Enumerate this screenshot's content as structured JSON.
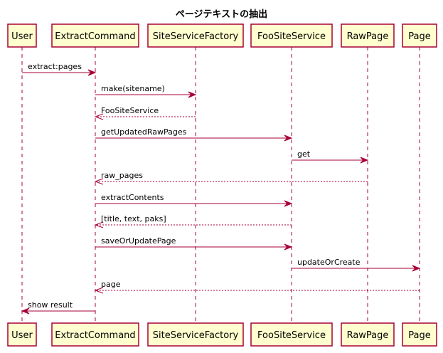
{
  "diagram": {
    "title": "ページテキストの抽出",
    "participants": [
      {
        "id": "user",
        "label": "User"
      },
      {
        "id": "extract",
        "label": "ExtractCommand"
      },
      {
        "id": "factory",
        "label": "SiteServiceFactory"
      },
      {
        "id": "foo",
        "label": "FooSiteService"
      },
      {
        "id": "raw",
        "label": "RawPage"
      },
      {
        "id": "page",
        "label": "Page"
      }
    ],
    "messages": [
      {
        "from": "user",
        "to": "extract",
        "label": "extract:pages",
        "style": "solid"
      },
      {
        "from": "extract",
        "to": "factory",
        "label": "make(sitename)",
        "style": "solid"
      },
      {
        "from": "factory",
        "to": "extract",
        "label": "FooSiteService",
        "style": "dashed"
      },
      {
        "from": "extract",
        "to": "foo",
        "label": "getUpdatedRawPages",
        "style": "solid"
      },
      {
        "from": "foo",
        "to": "raw",
        "label": "get",
        "style": "solid"
      },
      {
        "from": "raw",
        "to": "extract",
        "label": "raw_pages",
        "style": "dashed"
      },
      {
        "from": "extract",
        "to": "foo",
        "label": "extractContents",
        "style": "solid"
      },
      {
        "from": "foo",
        "to": "extract",
        "label": "[title, text, paks]",
        "style": "dashed"
      },
      {
        "from": "extract",
        "to": "foo",
        "label": "saveOrUpdatePage",
        "style": "solid"
      },
      {
        "from": "foo",
        "to": "page",
        "label": "updateOrCreate",
        "style": "solid"
      },
      {
        "from": "page",
        "to": "extract",
        "label": "page",
        "style": "dashed"
      },
      {
        "from": "extract",
        "to": "user",
        "label": "show result",
        "style": "solid"
      }
    ],
    "colors": {
      "participant_fill": "#FEFECE",
      "line": "#A80036"
    }
  }
}
